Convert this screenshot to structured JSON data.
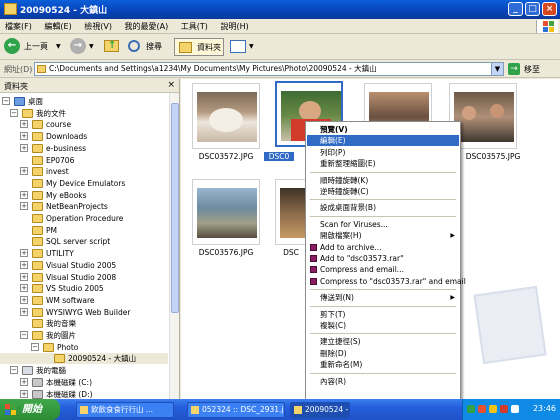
{
  "window": {
    "title": "20090524 - 大鎮山",
    "controls": {
      "minimize": "_",
      "maximize": "□",
      "close": "×"
    }
  },
  "menubar": {
    "items": [
      "檔案(F)",
      "編輯(E)",
      "檢視(V)",
      "我的最愛(A)",
      "工具(T)",
      "說明(H)"
    ]
  },
  "toolbar": {
    "back_label": "上一頁",
    "search_label": "搜尋",
    "folders_label": "資料夾"
  },
  "address": {
    "label": "網址(D)",
    "value": "C:\\Documents and Settings\\a1234\\My Documents\\My Pictures\\Photo\\20090524 - 大鎮山",
    "go_label": "移至"
  },
  "tree": {
    "header": "資料夾",
    "close": "×",
    "items": [
      {
        "label": "桌面",
        "expander": "−"
      },
      {
        "label": "我的文件",
        "expander": "−"
      },
      {
        "label": "course",
        "expander": "+"
      },
      {
        "label": "Downloads",
        "expander": "+"
      },
      {
        "label": "e-business",
        "expander": "+"
      },
      {
        "label": "EP0706",
        "expander": ""
      },
      {
        "label": "invest",
        "expander": "+"
      },
      {
        "label": "My Device Emulators",
        "expander": ""
      },
      {
        "label": "My eBooks",
        "expander": "+"
      },
      {
        "label": "NetBeanProjects",
        "expander": "+"
      },
      {
        "label": "Operation Procedure",
        "expander": ""
      },
      {
        "label": "PM",
        "expander": ""
      },
      {
        "label": "SQL server script",
        "expander": ""
      },
      {
        "label": "UTILITY",
        "expander": "+"
      },
      {
        "label": "Visual Studio 2005",
        "expander": "+"
      },
      {
        "label": "Visual Studio 2008",
        "expander": "+"
      },
      {
        "label": "VS Studio 2005",
        "expander": "+"
      },
      {
        "label": "WM software",
        "expander": "+"
      },
      {
        "label": "WYSIWYG Web Builder",
        "expander": "+"
      },
      {
        "label": "我的音樂",
        "expander": ""
      },
      {
        "label": "我的圖片",
        "expander": "−"
      },
      {
        "label": "Photo",
        "expander": "−"
      },
      {
        "label": "20090524 - 大鎮山",
        "expander": ""
      },
      {
        "label": "我的電腦",
        "expander": "−"
      },
      {
        "label": "本機磁碟 (C:)",
        "expander": "+"
      },
      {
        "label": "本機磁碟 (D:)",
        "expander": "+"
      }
    ]
  },
  "thumbnails": [
    {
      "caption": "DSC03572.JPG"
    },
    {
      "caption": "DSC0"
    },
    {
      "caption": ""
    },
    {
      "caption": "DSC03575.JPG"
    },
    {
      "caption": "DSC03576.JPG"
    },
    {
      "caption": "DSC"
    },
    {
      "caption": ""
    },
    {
      "caption": ""
    }
  ],
  "context_menu": {
    "items": [
      {
        "label": "預覽(V)",
        "bold": true
      },
      {
        "label": "編輯(E)",
        "highlight": true
      },
      {
        "label": "列印(P)"
      },
      {
        "label": "重新整理縮圖(E)"
      },
      {
        "sep": true
      },
      {
        "label": "順時鐘旋轉(K)"
      },
      {
        "label": "逆時鐘旋轉(C)"
      },
      {
        "sep": true
      },
      {
        "label": "設成桌面背景(B)"
      },
      {
        "sep": true
      },
      {
        "label": "Scan for Viruses..."
      },
      {
        "label": "開啟檔案(H)",
        "submenu": true
      },
      {
        "label": "Add to archive...",
        "rar": true
      },
      {
        "label": "Add to \"dsc03573.rar\"",
        "rar": true
      },
      {
        "label": "Compress and email...",
        "rar": true
      },
      {
        "label": "Compress to \"dsc03573.rar\" and email",
        "rar": true
      },
      {
        "sep": true
      },
      {
        "label": "傳送到(N)",
        "submenu": true
      },
      {
        "sep": true
      },
      {
        "label": "剪下(T)"
      },
      {
        "label": "複製(C)"
      },
      {
        "sep": true
      },
      {
        "label": "建立捷徑(S)"
      },
      {
        "label": "刪除(D)"
      },
      {
        "label": "重新命名(M)"
      },
      {
        "sep": true
      },
      {
        "label": "內容(R)"
      }
    ]
  },
  "taskbar": {
    "start_label": "開始",
    "tasks": [
      {
        "label": "飲飲食食行行山 ..."
      },
      {
        "label": "052324 :: DSC_2931.j..."
      },
      {
        "label": "20090524 - 大..."
      }
    ],
    "clock": "23:46"
  },
  "colors": {
    "selection": "#316ac5",
    "title_bar": "#0a5fd8",
    "taskbar": "#245edb",
    "start_button": "#3fa84a"
  }
}
